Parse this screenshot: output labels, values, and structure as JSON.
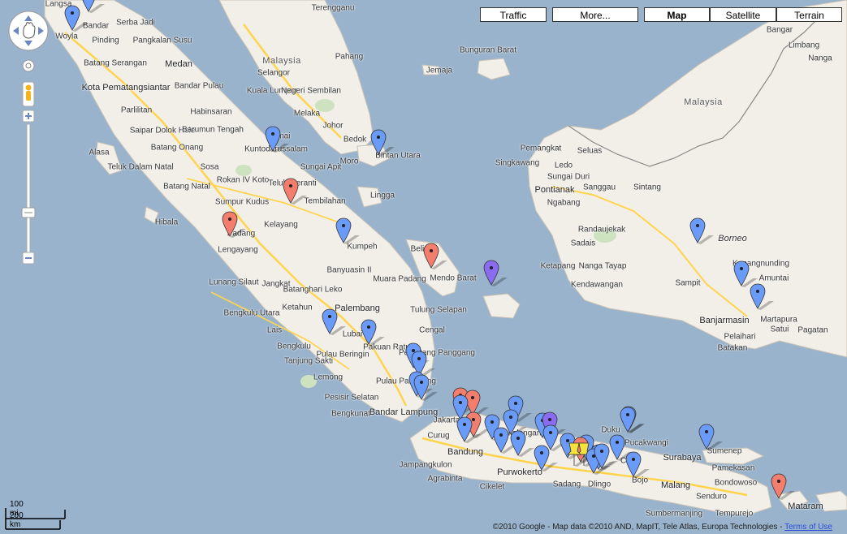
{
  "map_types": {
    "traffic": "Traffic",
    "more": "More...",
    "map": "Map",
    "satellite": "Satellite",
    "terrain": "Terrain",
    "active": "Map"
  },
  "scale": {
    "imperial": "100 mi",
    "metric": "200 km"
  },
  "attribution": {
    "text": "©2010 Google - Map data ©2010 AND, MapIT, Tele Atlas, Europa Technologies - ",
    "terms": "Terms of Use"
  },
  "colors": {
    "water": "#99b3cc",
    "land": "#f2efe9",
    "road_major": "#ffd44d",
    "marker_blue": "#6b9bf8",
    "marker_red": "#f37e6e",
    "marker_purple": "#8a6cf0",
    "marker_yellow": "#f6e23a"
  },
  "labels": {
    "langsa": "Langsa",
    "bandar": "Bandar",
    "woyla": "Woyla",
    "serba_jadi": "Serba Jadi",
    "pinding": "Pinding",
    "pangkalan_susu": "Pangkalan Susu",
    "batang_serangan": "Batang Serangan",
    "medan": "Medan",
    "kota_pematangsiantar": "Kota Pematangsiantar",
    "bandar_pulau": "Bandar Pulau",
    "parlilitan": "Parlilitan",
    "habinsaran": "Habinsaran",
    "saipar_dolok_hole": "Saipar Dolok Hole",
    "barumun_tengah": "Barumun Tengah",
    "alasa": "Alasa",
    "batang_onang": "Batang Onang",
    "teluk_dalam": "Teluk Dalam",
    "natal": "Natal",
    "sosa": "Sosa",
    "batang_natal": "Batang Natal",
    "rokan_iv_koto": "Rokan IV Koto",
    "sumpur_kudus": "Sumpur Kudus",
    "hibala": "Hibala",
    "padang": "Padang",
    "lengayang": "Lengayang",
    "dumai": "Dumai",
    "kuntodarussalam": "Kuntodarussalam",
    "sungai_apit": "Sungai Apit",
    "teluk_meranti": "Teluk Meranti",
    "tembilahan": "Tembilahan",
    "kelayang": "Kelayang",
    "malaysia_w": "Malaysia",
    "selangor": "Selangor",
    "kuala_lumpur": "Kuala Lumpur",
    "negeri_sembilan": "Negeri Sembilan",
    "melaka": "Melaka",
    "johor": "Johor",
    "pahang": "Pahang",
    "terengganu": "Terengganu",
    "bedok": "Bedok",
    "moro": "Moro",
    "bintan_utara": "Bintan Utara",
    "lingga": "Lingga",
    "bunguran_barat": "Bunguran Barat",
    "jemaja": "Jemaja",
    "kumpeh": "Kumpeh",
    "banyuasin_ii": "Banyuasin II",
    "belinyu": "Belinyu",
    "mendo_barat": "Mendo Barat",
    "muara_padang": "Muara Padang",
    "lunang_silaut": "Lunang Silaut",
    "jangkat": "Jangkat",
    "batanghari_leko": "Batanghari Leko",
    "palembang": "Palembang",
    "ketahun": "Ketahun",
    "bengkulu_utara": "Bengkulu Utara",
    "lais": "Lais",
    "bengkulu": "Bengkulu",
    "tanjung_sakti": "Tanjung Sakti",
    "pulau_beringin": "Pulau Beringin",
    "lubai": "Lubai",
    "pakuan_ratu": "Pakuan Ratu",
    "tulung_selapan": "Tulung Selapan",
    "cengal": "Cengal",
    "pematang_panggang": "Pematang Panggang",
    "lemong": "Lemong",
    "pulau_panggung": "Pulau Panggung",
    "pesisir_selatan": "Pesisir Selatan",
    "bengkunat": "Bengkunat",
    "bandar_lampung": "Bandar Lampung",
    "jakarta": "Jakarta",
    "curug": "Curug",
    "bandung": "Bandung",
    "jampangkulon": "Jampangkulon",
    "agrabinta": "Agrabinta",
    "cikelet": "Cikelet",
    "purwokerto": "Purwokerto",
    "pekalongan": "Pekalongan",
    "semarang": "Semarang",
    "sadang": "Sadang",
    "dlingo": "Dlingo",
    "duku": "Duku",
    "pucakwangi": "Pucakwangi",
    "cepu": "Cepu",
    "bojo": "Bojo",
    "surabaya": "Surabaya",
    "sumenep": "Sumenep",
    "pamekasan": "Pamekasan",
    "bondowoso": "Bondowoso",
    "malang": "Malang",
    "sumbermanjing": "Sumbermanjing",
    "senduro": "Senduro",
    "tempurejo": "Tempurejo",
    "mataram": "Mataram",
    "pemangkat": "Pemangkat",
    "seluas": "Seluas",
    "singkawang": "Singkawang",
    "ledo": "Ledo",
    "sungai_duri": "Sungai Duri",
    "pontianak": "Pontianak",
    "sanggau": "Sanggau",
    "sintang": "Sintang",
    "ngabang": "Ngabang",
    "randaujekak": "Randaujekak",
    "sadais": "Sadais",
    "ketapang": "Ketapang",
    "nanga_tayap": "Nanga Tayap",
    "kendawangan": "Kendawangan",
    "malaysia_e": "Malaysia",
    "borneo": "Borneo",
    "kupangnunding": "Kupangnunding",
    "sampit": "Sampit",
    "amuntai": "Amuntai",
    "martapura": "Martapura",
    "banjarmasin": "Banjarmasin",
    "pelaihari": "Pelaihari",
    "satui": "Satui",
    "batakan": "Batakan",
    "pagatan": "Pagatan",
    "nanga": "Nanga",
    "bangar": "Bangar",
    "limbang": "Limbang"
  },
  "markers": [
    {
      "name": "marker-aceh-1",
      "color": "blue"
    },
    {
      "name": "marker-aceh-2",
      "color": "blue"
    },
    {
      "name": "marker-dumai",
      "color": "blue"
    },
    {
      "name": "marker-bintan",
      "color": "blue"
    },
    {
      "name": "marker-tembilahan",
      "color": "red"
    },
    {
      "name": "marker-padang",
      "color": "red"
    },
    {
      "name": "marker-kumpeh",
      "color": "blue"
    },
    {
      "name": "marker-bangka",
      "color": "red"
    },
    {
      "name": "marker-belitung",
      "color": "purple"
    },
    {
      "name": "marker-lubai",
      "color": "blue"
    },
    {
      "name": "marker-pakuan",
      "color": "blue"
    },
    {
      "name": "marker-lampung-1",
      "color": "blue"
    },
    {
      "name": "marker-lampung-2",
      "color": "blue"
    },
    {
      "name": "marker-lampung-3",
      "color": "blue"
    },
    {
      "name": "marker-lampung-4",
      "color": "blue"
    },
    {
      "name": "marker-jakarta-1",
      "color": "red"
    },
    {
      "name": "marker-jakarta-2",
      "color": "red"
    },
    {
      "name": "marker-jakarta-3",
      "color": "blue"
    },
    {
      "name": "marker-bandung-1",
      "color": "red"
    },
    {
      "name": "marker-bandung-2",
      "color": "blue"
    },
    {
      "name": "marker-java-1",
      "color": "blue"
    },
    {
      "name": "marker-java-2",
      "color": "blue"
    },
    {
      "name": "marker-java-3",
      "color": "blue"
    },
    {
      "name": "marker-java-4",
      "color": "blue"
    },
    {
      "name": "marker-java-5",
      "color": "blue"
    },
    {
      "name": "marker-java-6",
      "color": "blue"
    },
    {
      "name": "marker-java-7",
      "color": "blue"
    },
    {
      "name": "marker-java-8",
      "color": "purple"
    },
    {
      "name": "marker-java-9",
      "color": "blue"
    },
    {
      "name": "marker-java-10",
      "color": "blue"
    },
    {
      "name": "marker-java-11",
      "color": "blue"
    },
    {
      "name": "marker-semarang-1",
      "color": "red"
    },
    {
      "name": "marker-semarang-2",
      "color": "yellow"
    },
    {
      "name": "marker-semarang-3",
      "color": "yellow"
    },
    {
      "name": "marker-java-12",
      "color": "blue"
    },
    {
      "name": "marker-java-13",
      "color": "blue"
    },
    {
      "name": "marker-java-14",
      "color": "blue"
    },
    {
      "name": "marker-java-15",
      "color": "blue"
    },
    {
      "name": "marker-java-16",
      "color": "blue"
    },
    {
      "name": "marker-java-17",
      "color": "blue"
    },
    {
      "name": "marker-pucakwangi",
      "color": "blue"
    },
    {
      "name": "marker-surabaya-east",
      "color": "blue"
    },
    {
      "name": "marker-mataram",
      "color": "red"
    },
    {
      "name": "marker-borneo-1",
      "color": "blue"
    },
    {
      "name": "marker-borneo-2",
      "color": "blue"
    },
    {
      "name": "marker-borneo-3",
      "color": "blue"
    }
  ]
}
